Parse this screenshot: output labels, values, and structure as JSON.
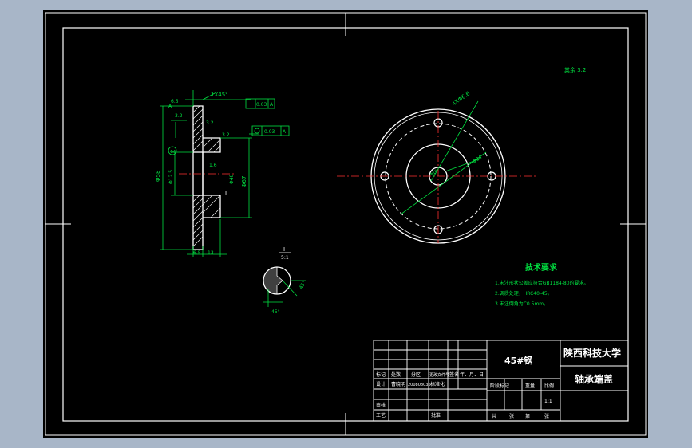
{
  "title_block": {
    "material": "45#钢",
    "school": "陕西科技大学",
    "part_name": "轴承端盖",
    "row_headers": [
      "标记",
      "处数",
      "分区",
      "更改文件号",
      "签名",
      "年、月、日"
    ],
    "designer_label": "设计",
    "designer_name": "曹晓明",
    "student_no": "200808036",
    "standardization_label": "标准化",
    "review_label": "审核",
    "process_label": "工艺",
    "approve_label": "批准",
    "stage_headers": [
      "阶段标记",
      "重量",
      "比例"
    ],
    "scale": "1:1",
    "sheet_info": [
      "共",
      "张",
      "第",
      "张"
    ]
  },
  "tech_req": {
    "title": "技术要求",
    "items": [
      "1.未注形状公差应符合GB1184-80的要求。",
      "2.调质处理，HRC40-45。",
      "3.未注倒角为C0.5mm。"
    ]
  },
  "roughness_corner": "其余 3.2",
  "dims": {
    "chamfer": "1X45°",
    "tol_1": "0.03",
    "tol_ref_1": "A",
    "tol_2": "0.03",
    "tol_ref_2": "A",
    "d1": "6.5",
    "d2": "3.2",
    "d3": "3.2",
    "d4": "Φ4",
    "d5": "Φ58",
    "d6": "Φ12.5",
    "d7": "Φ40",
    "d8": "Φ67",
    "d9": "1.6",
    "d10": "6.5",
    "d11": "13",
    "d12": "3.2",
    "datum": "A",
    "view_label": "I",
    "detail_label": "I",
    "detail_scale": "5:1",
    "detail_angle_1": "45°",
    "detail_angle_2": "45°",
    "pcd": "4XΦ6.6",
    "pitch": "Φ84",
    "center": "Φ10"
  }
}
